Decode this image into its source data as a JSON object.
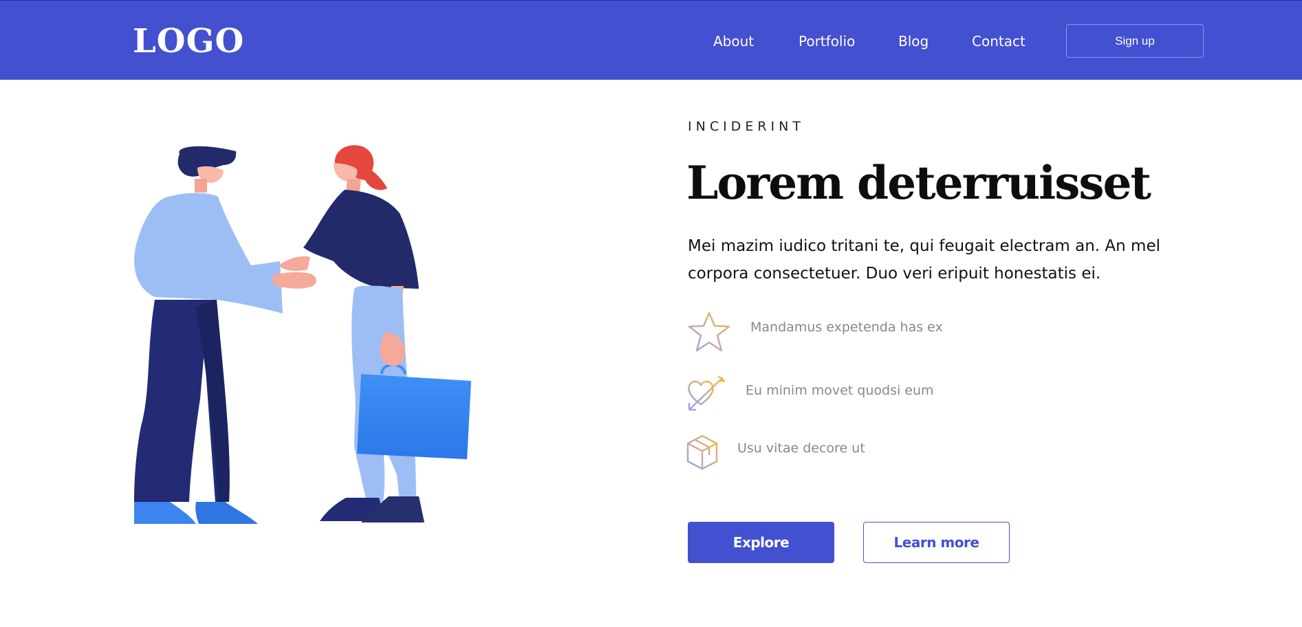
{
  "header": {
    "logo": "LOGO",
    "nav": [
      {
        "label": "About"
      },
      {
        "label": "Portfolio"
      },
      {
        "label": "Blog"
      },
      {
        "label": "Contact"
      }
    ],
    "signup_label": "Sign up"
  },
  "hero": {
    "eyebrow": "INCIDERINT",
    "title": "Lorem deterruisset",
    "lead": "Mei mazim iudico tritani te, qui feugait electram an. An mel corpora consectetuer. Duo veri eripuit honestatis ei.",
    "features": [
      {
        "icon": "star-icon",
        "label": "Mandamus expetenda has ex"
      },
      {
        "icon": "heart-arrow-icon",
        "label": "Eu minim movet quodsi eum"
      },
      {
        "icon": "box-icon",
        "label": "Usu vitae decore ut"
      }
    ],
    "primary_button": "Explore",
    "secondary_button": "Learn more"
  },
  "colors": {
    "brand": "#4350d0",
    "icon_gradient_start": "#9ba3ee",
    "icon_gradient_end": "#f1b94c"
  }
}
